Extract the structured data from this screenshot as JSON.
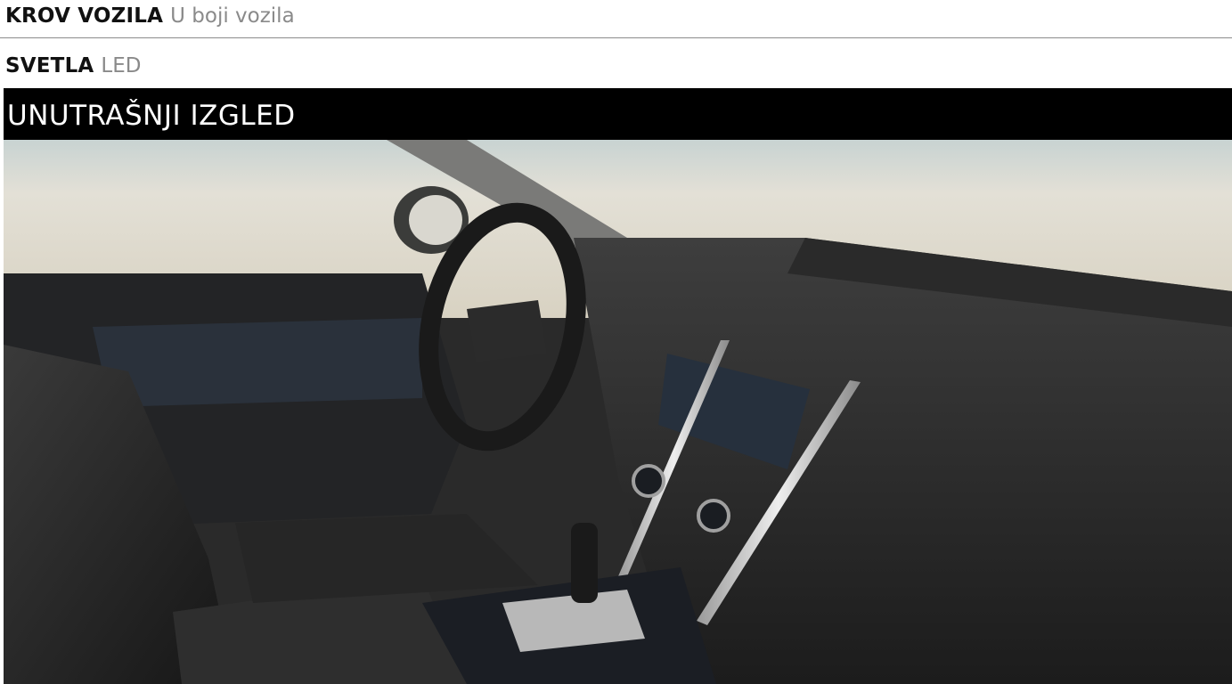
{
  "specs": {
    "roof": {
      "label": "KROV VOZILA",
      "value": "U boji vozila"
    },
    "lights": {
      "label": "SVETLA",
      "value": "LED"
    }
  },
  "section": {
    "title": "UNUTRAŠNJI IZGLED"
  },
  "image": {
    "subject": "vehicle interior view"
  },
  "colors": {
    "header_bg": "#000000",
    "value_text": "#8a8a8a"
  }
}
